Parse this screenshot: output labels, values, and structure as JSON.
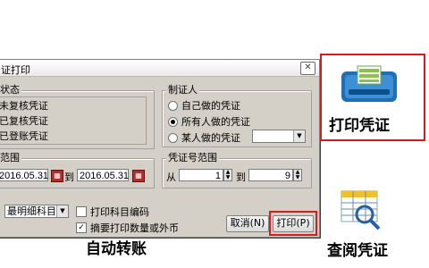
{
  "dialog": {
    "title": "证打印",
    "close_label": "✕",
    "status_group": {
      "legend": "状态",
      "items": [
        "未复核凭证",
        "已复核凭证",
        "已登账凭证"
      ]
    },
    "maker_group": {
      "legend": "制证人",
      "options": [
        "自己做的凭证",
        "所有人做的凭证",
        "某人做的凭证"
      ],
      "selected_index": 1
    },
    "date_group": {
      "legend": "范围",
      "from": "2016.05.31",
      "to_label": "到",
      "to": "2016.05.31"
    },
    "number_group": {
      "legend": "凭证号范围",
      "from_label": "从",
      "from_value": "1",
      "to_label": "到",
      "to_value": "9"
    },
    "detail_select": "最明细科目",
    "print_code_label": "打印科目编码",
    "print_code_checked": false,
    "summary_label": "摘要打印数量或外币",
    "summary_checked": true,
    "cancel_label": "取消(N)",
    "print_label": "打印(P)"
  },
  "captions": {
    "auto_transfer": "自动转账",
    "print_voucher": "打印凭证",
    "view_voucher": "查阅凭证"
  },
  "colors": {
    "highlight_red": "#d21e1e",
    "dialog_bg": "#d4d0c8"
  },
  "icons": [
    "printer-icon",
    "magnifier-table-icon"
  ]
}
